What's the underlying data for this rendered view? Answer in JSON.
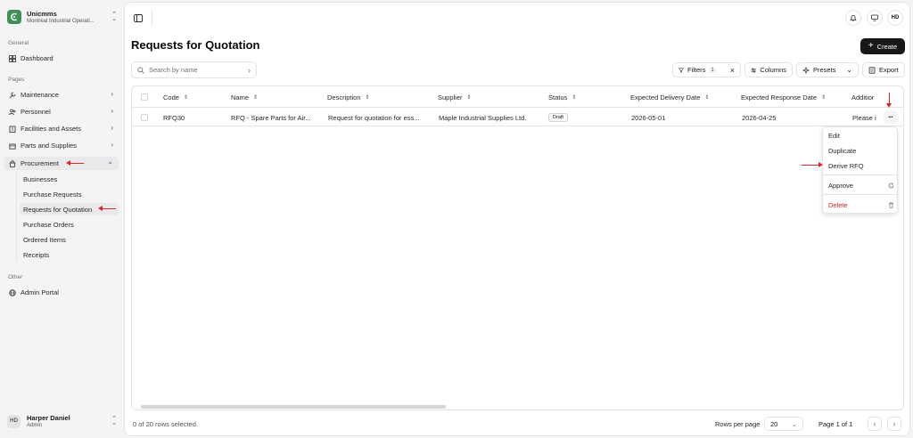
{
  "workspace": {
    "name": "Unicmms",
    "subtitle": "Montreal Industrial Operati..."
  },
  "sidebar": {
    "general_label": "General",
    "dashboard": "Dashboard",
    "pages_label": "Pages",
    "items": [
      {
        "label": "Maintenance",
        "icon": "wrench-icon"
      },
      {
        "label": "Personnel",
        "icon": "people-icon"
      },
      {
        "label": "Facilities and Assets",
        "icon": "building-icon"
      },
      {
        "label": "Parts and Supplies",
        "icon": "box-icon"
      },
      {
        "label": "Procurement",
        "icon": "bag-icon"
      }
    ],
    "procurement_sub": [
      "Businesses",
      "Purchase Requests",
      "Requests for Quotation",
      "Purchase Orders",
      "Ordered Items",
      "Receipts"
    ],
    "other_label": "Other",
    "admin_portal": "Admin Portal"
  },
  "user": {
    "name": "Harper Daniel",
    "role": "Admin",
    "initials": "HD"
  },
  "header": {
    "initials": "HD"
  },
  "page": {
    "title": "Requests for Quotation",
    "create_label": "Create"
  },
  "toolbar": {
    "search_placeholder": "Search by name",
    "filters_label": "Filters",
    "filters_count": "1",
    "columns_label": "Columns",
    "presets_label": "Presets",
    "export_label": "Export"
  },
  "table": {
    "columns": [
      "Code",
      "Name",
      "Description",
      "Supplier",
      "Status",
      "Expected Delivery Date",
      "Expected Response Date",
      "Additior"
    ],
    "rows": [
      {
        "code": "RFQ30",
        "name": "RFQ - Spare Parts for Air...",
        "description": "Request for quotation for ess...",
        "supplier": "Maple Industrial Supplies Ltd.",
        "status": "Draft",
        "delivery": "2026-05-01",
        "response": "2026-04-25",
        "additional": "Please i"
      }
    ]
  },
  "row_menu": {
    "items": [
      "Edit",
      "Duplicate",
      "Derive RFQ",
      "Approve",
      "Delete"
    ]
  },
  "footer": {
    "selected": "0 of 20 rows selected.",
    "rows_per_page_label": "Rows per page",
    "rows_per_page": "20",
    "page_info": "Page 1 of 1"
  },
  "colors": {
    "brand": "#3f8f56",
    "danger": "#dc2626",
    "annotation": "#dc2626"
  }
}
